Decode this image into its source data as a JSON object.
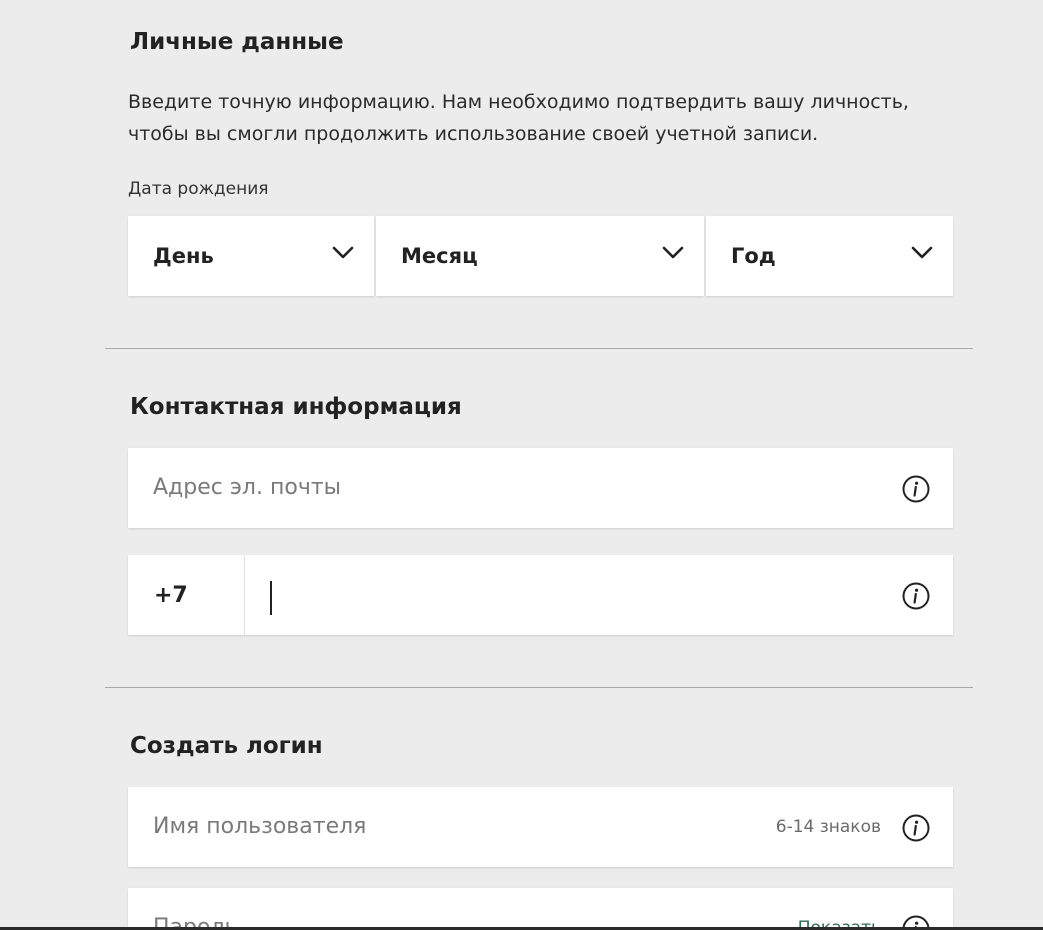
{
  "personal": {
    "title": "Личные данные",
    "description": "Введите точную информацию. Нам необходимо подтвердить вашу личность, чтобы вы смогли продолжить использование своей учетной записи.",
    "dob_label": "Дата рождения",
    "day": "День",
    "month": "Месяц",
    "year": "Год"
  },
  "contact": {
    "title": "Контактная информация",
    "email_placeholder": "Адрес эл. почты",
    "phone_prefix": "+7",
    "phone_value": ""
  },
  "login": {
    "title": "Создать логин",
    "username_placeholder": "Имя пользователя",
    "username_hint": "6-14 знаков",
    "password_placeholder": "Пароль",
    "password_show": "Показать"
  },
  "icons": {
    "dropdown": "chevron-down-icon",
    "info": "info-icon"
  }
}
